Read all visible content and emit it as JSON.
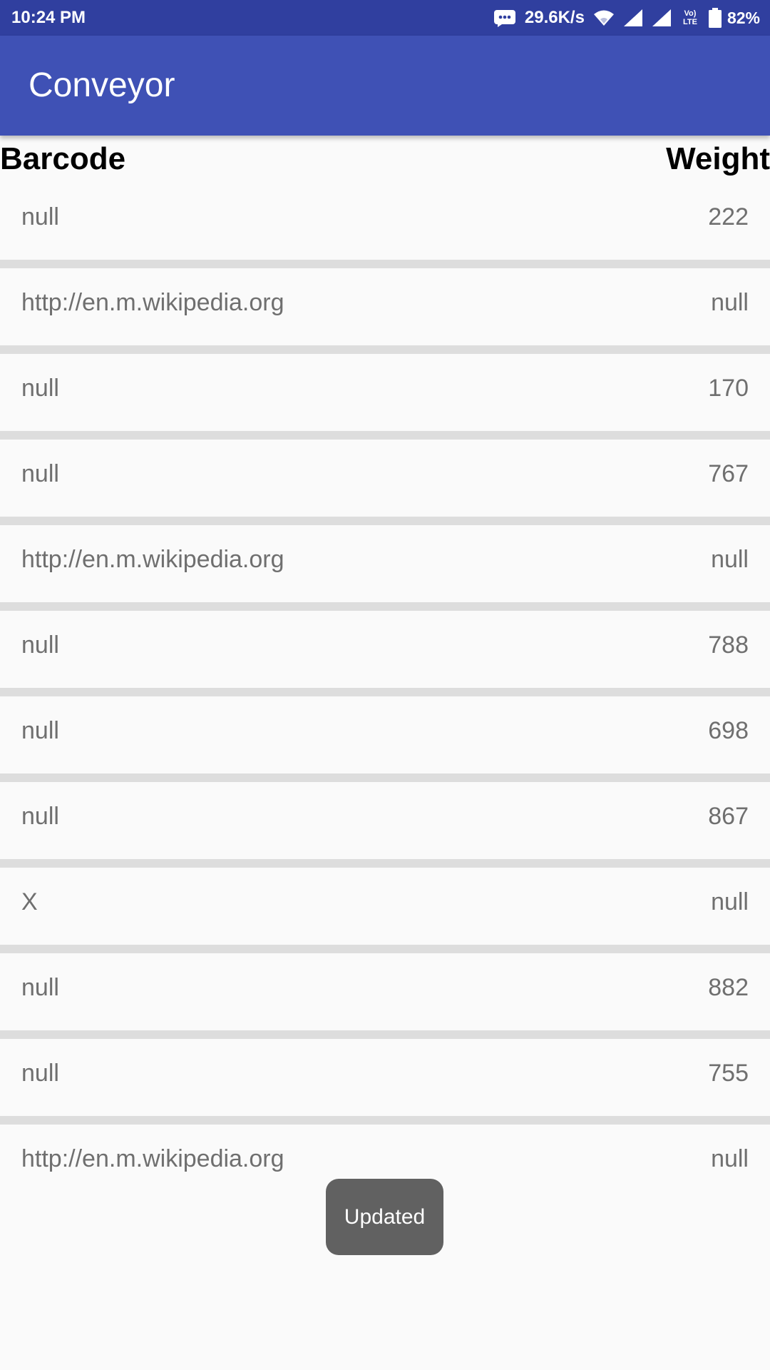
{
  "status_bar": {
    "time": "10:24 PM",
    "net_speed": "29.6K/s",
    "lte_top": "Vo)",
    "lte_bottom": "LTE",
    "battery": "82%"
  },
  "app_bar": {
    "title": "Conveyor"
  },
  "table": {
    "headers": {
      "barcode": "Barcode",
      "weight": "Weight"
    },
    "rows": [
      {
        "barcode": "null",
        "weight": "222"
      },
      {
        "barcode": "http://en.m.wikipedia.org",
        "weight": "null"
      },
      {
        "barcode": "null",
        "weight": "170"
      },
      {
        "barcode": "null",
        "weight": "767"
      },
      {
        "barcode": "http://en.m.wikipedia.org",
        "weight": "null"
      },
      {
        "barcode": "null",
        "weight": "788"
      },
      {
        "barcode": "null",
        "weight": "698"
      },
      {
        "barcode": "null",
        "weight": "867"
      },
      {
        "barcode": "X",
        "weight": "null"
      },
      {
        "barcode": "null",
        "weight": "882"
      },
      {
        "barcode": "null",
        "weight": "755"
      },
      {
        "barcode": "http://en.m.wikipedia.org",
        "weight": "null"
      }
    ]
  },
  "toast": {
    "message": "Updated"
  },
  "colors": {
    "status_bar": "#303f9f",
    "app_bar": "#3f51b5",
    "divider": "#dddddd",
    "toast": "#616161"
  }
}
